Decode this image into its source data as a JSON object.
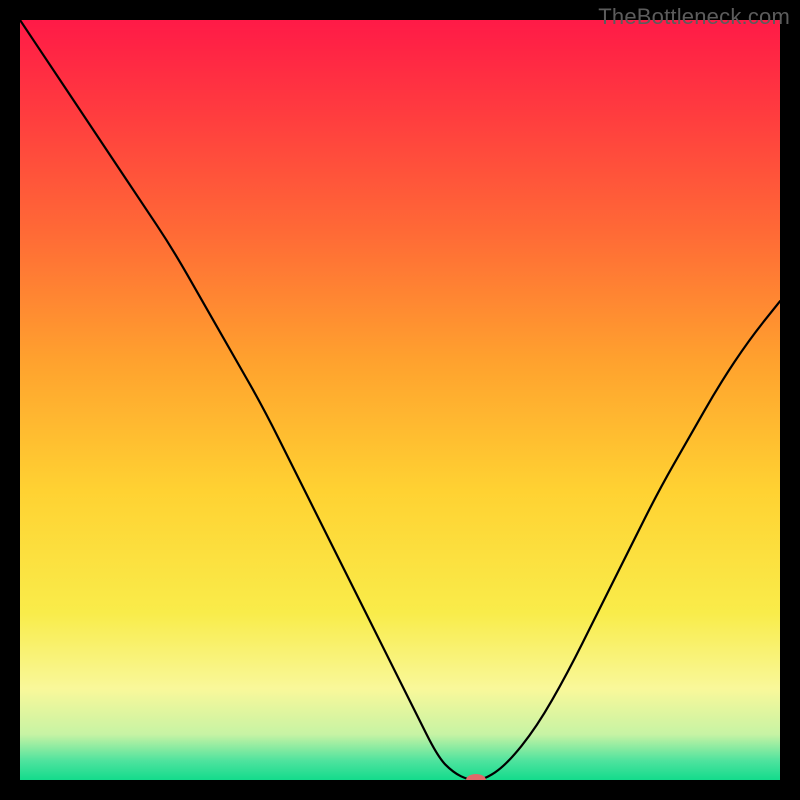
{
  "watermark": "TheBottleneck.com",
  "chart_data": {
    "type": "line",
    "title": "",
    "xlabel": "",
    "ylabel": "",
    "xlim": [
      0,
      100
    ],
    "ylim": [
      0,
      100
    ],
    "grid": false,
    "legend": false,
    "background": {
      "type": "vertical-gradient",
      "stops": [
        {
          "pos": 0.0,
          "color": "#ff1a47"
        },
        {
          "pos": 0.12,
          "color": "#ff3b3f"
        },
        {
          "pos": 0.28,
          "color": "#ff6a36"
        },
        {
          "pos": 0.45,
          "color": "#ffa22e"
        },
        {
          "pos": 0.62,
          "color": "#ffd232"
        },
        {
          "pos": 0.78,
          "color": "#f9ec4a"
        },
        {
          "pos": 0.88,
          "color": "#f9f89a"
        },
        {
          "pos": 0.94,
          "color": "#c7f3a4"
        },
        {
          "pos": 0.975,
          "color": "#4ee39e"
        },
        {
          "pos": 1.0,
          "color": "#13db8c"
        }
      ]
    },
    "series": [
      {
        "name": "bottleneck-curve",
        "stroke": "#000000",
        "stroke_width": 2.2,
        "x": [
          0,
          4,
          8,
          12,
          16,
          20,
          24,
          28,
          32,
          36,
          40,
          44,
          48,
          52,
          55,
          57,
          59,
          61,
          64,
          68,
          72,
          76,
          80,
          84,
          88,
          92,
          96,
          100
        ],
        "y": [
          100,
          94,
          88,
          82,
          76,
          70,
          63,
          56,
          49,
          41,
          33,
          25,
          17,
          9,
          3,
          1,
          0,
          0,
          2,
          7,
          14,
          22,
          30,
          38,
          45,
          52,
          58,
          63
        ]
      }
    ],
    "marker": {
      "name": "minimum-marker",
      "x": 60,
      "y": 0,
      "color": "#e06a6a",
      "rx": 10,
      "ry": 6
    }
  }
}
